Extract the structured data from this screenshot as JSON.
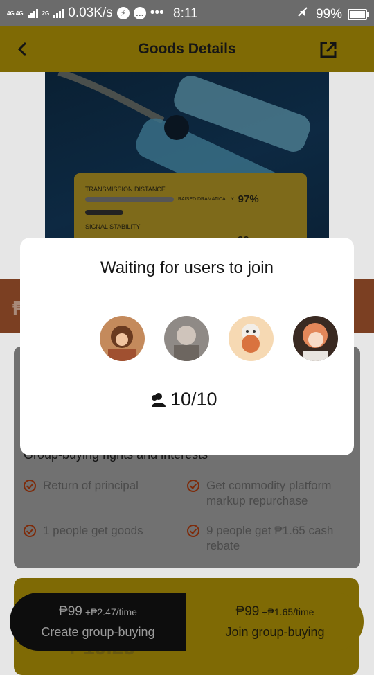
{
  "status_bar": {
    "network": "4G 4G",
    "network2": "2G",
    "speed": "0.03K/s",
    "time": "8:11",
    "battery": "99%"
  },
  "header": {
    "title": "Goods Details",
    "back_icon": "chevron-left-icon",
    "share_icon": "external-link-icon"
  },
  "product_card": {
    "spec1": "TRANSMISSION DISTANCE",
    "spec1_note": "RAISED DRAMATICALLY",
    "spec1_value": "97%",
    "spec2": "SIGNAL STABILITY",
    "spec2_value": "99"
  },
  "banner": {
    "currency": "₱"
  },
  "rights": {
    "title": "Group-buying rights and interests",
    "items": [
      "Return of principal",
      "Get commodity platform markup repurchase",
      "1 people get goods",
      "9 people get ₱1.65 cash rebate"
    ]
  },
  "gold_card": {
    "price_fragment": "₱19.25"
  },
  "actions": {
    "create": {
      "price": "₱99",
      "extra": "+₱2.47/time",
      "label": "Create group-buying"
    },
    "join": {
      "price": "₱99",
      "extra": "+₱1.65/time",
      "label": "Join group-buying"
    }
  },
  "modal": {
    "title": "Waiting for users to join",
    "count": "10/10",
    "users_icon": "users-icon",
    "avatars": [
      "avatar-1",
      "avatar-2",
      "avatar-3",
      "avatar-4"
    ]
  },
  "colors": {
    "accent": "#FFD400",
    "overlay": "rgba(0,0,0,0.5)",
    "check": "#E8551C"
  }
}
